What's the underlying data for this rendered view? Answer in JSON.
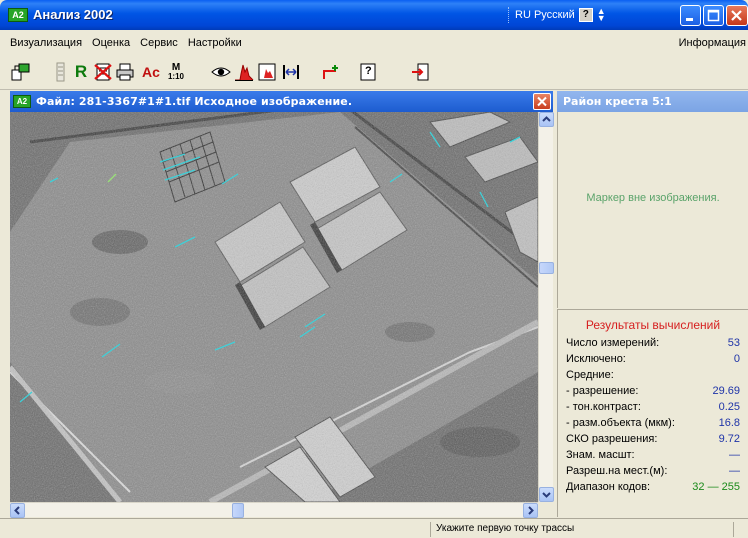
{
  "window": {
    "icon_text": "A2",
    "title": "Анализ 2002",
    "language": "RU Русский",
    "help_glyph": "?"
  },
  "menu": {
    "items": [
      "Визуализация",
      "Оценка",
      "Сервис",
      "Настройки"
    ],
    "info": "Информация"
  },
  "toolbar": {
    "r_label": "R",
    "ac_label": "Ac",
    "m_label": "M",
    "scale_label": "1:10",
    "help_label": "?"
  },
  "image_window": {
    "icon_text": "A2",
    "title": "Файл: 281-3367#1#1.tif  Исходное изображение."
  },
  "cross_panel": {
    "title": "Район креста 5:1",
    "message": "Маркер вне изображения."
  },
  "results": {
    "title": "Результаты вычислений",
    "rows": [
      {
        "label": "Число измерений:",
        "value": "53"
      },
      {
        "label": "Исключено:",
        "value": "0"
      },
      {
        "label": "Средние:",
        "value": ""
      },
      {
        "label": "- разрешение:",
        "value": "29.69"
      },
      {
        "label": "- тон.контраст:",
        "value": "0.25"
      },
      {
        "label": "- разм.объекта (мкм):",
        "value": "16.8"
      },
      {
        "label": "СКО разрешения:",
        "value": "9.72"
      },
      {
        "label": "Знам. масшт:",
        "value": "—"
      },
      {
        "label": "Разреш.на мест.(м):",
        "value": "—"
      },
      {
        "label": "Диапазон кодов:",
        "value": "32 — 255"
      }
    ]
  },
  "status": {
    "message": "Укажите первую точку трассы"
  },
  "colors": {
    "title_blue": "#0055e5",
    "results_title": "#d62020",
    "value_blue": "#1f34a8",
    "range_green": "#1a8a1a",
    "marker_msg": "#5aa36a",
    "trace_cyan": "#3fd0d8"
  }
}
